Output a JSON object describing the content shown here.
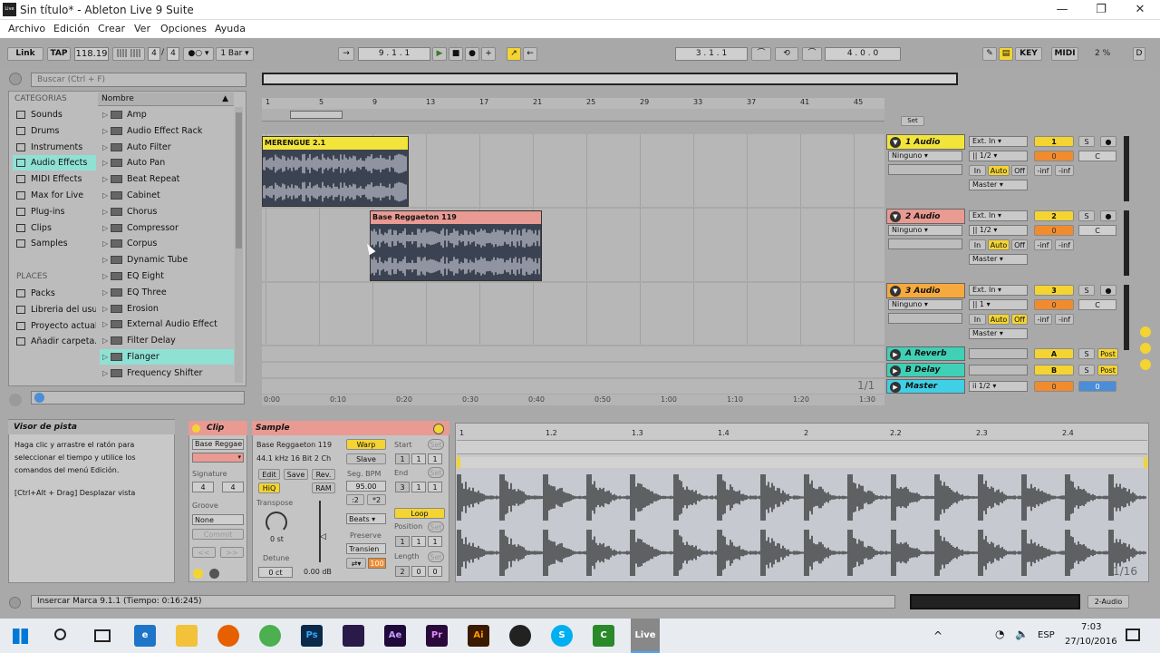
{
  "window": {
    "title": "Sin título* - Ableton Live 9 Suite",
    "app_icon": "Live",
    "min": "—",
    "max": "❐",
    "close": "✕"
  },
  "menu": [
    "Archivo",
    "Edición",
    "Crear",
    "Ver",
    "Opciones",
    "Ayuda"
  ],
  "transport": {
    "link": "Link",
    "tap": "TAP",
    "tempo": "118.19",
    "sig_num": "4",
    "sig_den": "4",
    "quant": "1 Bar",
    "position": "9 .  1 .  1",
    "loop_start": "3 .  1 .  1",
    "loop_len": "4 .  0 .  0",
    "key": "KEY",
    "midi": "MIDI",
    "cpu": "2 %",
    "d": "D"
  },
  "browser": {
    "search_placeholder": "Buscar (Ctrl + F)",
    "categories_title": "CATEGORIAS",
    "categories": [
      "Sounds",
      "Drums",
      "Instruments",
      "Audio Effects",
      "MIDI Effects",
      "Max for Live",
      "Plug-ins",
      "Clips",
      "Samples"
    ],
    "selected_category": "Audio Effects",
    "places_title": "PLACES",
    "places": [
      "Packs",
      "Libreria del usu",
      "Proyecto actual",
      "Añadir carpeta..."
    ],
    "name_header": "Nombre",
    "items": [
      "Amp",
      "Audio Effect Rack",
      "Auto Filter",
      "Auto Pan",
      "Beat Repeat",
      "Cabinet",
      "Chorus",
      "Compressor",
      "Corpus",
      "Dynamic Tube",
      "EQ Eight",
      "EQ Three",
      "Erosion",
      "External Audio Effect",
      "Filter Delay",
      "Flanger",
      "Frequency Shifter"
    ],
    "selected_item": "Flanger"
  },
  "arrangement": {
    "bar_marks": [
      "1",
      "5",
      "9",
      "13",
      "17",
      "21",
      "25",
      "29",
      "33",
      "37",
      "41",
      "45"
    ],
    "set_label": "Set",
    "time_marks": [
      "0:00",
      "0:10",
      "0:20",
      "0:30",
      "0:40",
      "0:50",
      "1:00",
      "1:10",
      "1:20",
      "1:30"
    ],
    "zoom": "1/1",
    "clips": [
      {
        "name": "MERENGUE 2.1",
        "color": "#f3e43a"
      },
      {
        "name": "Base Reggaeton 119",
        "color": "#e89a93"
      }
    ]
  },
  "tracks": [
    {
      "name": "1 Audio",
      "color": "#f3e43a",
      "input": "Ext. In",
      "channel": "1/2",
      "route": "Ninguno",
      "output": "Master",
      "num": "1",
      "vol": "0",
      "pan": "C",
      "inf1": "-inf",
      "inf2": "-inf"
    },
    {
      "name": "2 Audio",
      "color": "#e89a93",
      "input": "Ext. In",
      "channel": "1/2",
      "route": "Ninguno",
      "output": "Master",
      "num": "2",
      "vol": "0",
      "pan": "C",
      "inf1": "-inf",
      "inf2": "-inf"
    },
    {
      "name": "3 Audio",
      "color": "#f6a93e",
      "input": "Ext. In",
      "channel": "1",
      "route": "Ninguno",
      "output": "Master",
      "num": "3",
      "vol": "0",
      "pan": "C",
      "inf1": "-inf",
      "inf2": "-inf"
    }
  ],
  "returns": [
    {
      "name": "A Reverb",
      "letter": "A"
    },
    {
      "name": "B Delay",
      "letter": "B"
    }
  ],
  "master": {
    "name": "Master",
    "channel": "1/2",
    "vol": "0",
    "pan": "0"
  },
  "monitor": {
    "in": "In",
    "auto": "Auto",
    "off": "Off",
    "s": "S",
    "post": "Post"
  },
  "info": {
    "title": "Visor de pista",
    "body": "Haga clic y arrastre el ratón para seleccionar el tiempo y utilice los comandos del menú Edición.",
    "shortcut": "[Ctrl+Alt + Drag] Desplazar vista"
  },
  "clip_view": {
    "clip_title": "Clip",
    "clip_name": "Base Reggae",
    "signature": "Signature",
    "sig1": "4",
    "sig2": "4",
    "groove": "Groove",
    "groove_val": "None",
    "commit": "Commit",
    "sample_title": "Sample",
    "sample_name": "Base Reggaeton 119",
    "sample_info": "44.1 kHz 16 Bit 2 Ch",
    "edit": "Edit",
    "save": "Save",
    "rev": "Rev.",
    "hiq": "HiQ",
    "ram": "RAM",
    "transpose": "Transpose",
    "transpose_val": "0 st",
    "detune": "Detune",
    "detune_val": "0 ct",
    "gain": "0.00 dB",
    "warp": "Warp",
    "slave": "Slave",
    "seg_bpm": "Seg. BPM",
    "bpm": "95.00",
    "half": ":2",
    "double": "*2",
    "mode": "Beats",
    "preserve": "Preserve",
    "preserve_val": "Transien",
    "pct": "100",
    "start": "Start",
    "end": "End",
    "loop": "Loop",
    "position": "Position",
    "length": "Length",
    "set": "Set",
    "start_vals": [
      "1",
      "1",
      "1"
    ],
    "end_vals": [
      "3",
      "1",
      "1"
    ],
    "pos_vals": [
      "1",
      "1",
      "1"
    ],
    "len_vals": [
      "2",
      "0",
      "0"
    ],
    "ruler": [
      "1",
      "1.2",
      "1.3",
      "1.4",
      "2",
      "2.2",
      "2.3",
      "2.4"
    ],
    "zoom": "1/16"
  },
  "status": {
    "text": "Insercar Marca 9.1.1 (Tiempo: 0:16:245)",
    "track": "2-Audio"
  },
  "taskbar": {
    "lang": "ESP",
    "time": "7:03",
    "date": "27/10/2016",
    "apps": [
      "Ps",
      "Ae",
      "Pr",
      "Ai",
      "Live"
    ]
  }
}
